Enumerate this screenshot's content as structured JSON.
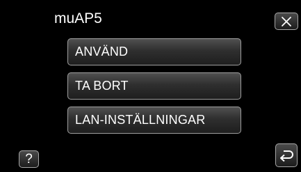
{
  "header": {
    "title": "muAP5",
    "close_icon": "close-icon"
  },
  "menu": {
    "items": [
      {
        "label": "ANVÄND"
      },
      {
        "label": "TA BORT"
      },
      {
        "label": "LAN-INSTÄLLNINGAR"
      }
    ]
  },
  "footer": {
    "help_label": "?",
    "help_icon": "question-icon",
    "back_icon": "return-arrow-icon"
  },
  "colors": {
    "background": "#000000",
    "button_border": "#a0a0a0",
    "text": "#ffffff"
  }
}
